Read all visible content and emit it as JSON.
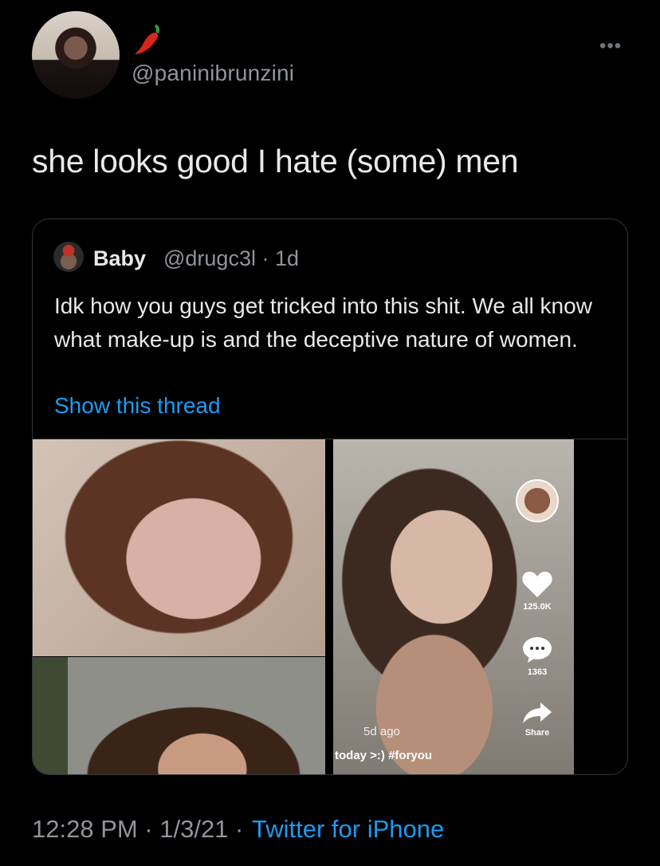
{
  "tweet": {
    "handle": "@paninibrunzini",
    "text": "she looks good I hate (some) men",
    "more_label": "•••",
    "timestamp": "12:28 PM · 1/3/21 ·",
    "source": "Twitter for iPhone"
  },
  "quote": {
    "name": "Baby",
    "meta": "@drugc3l · 1d",
    "text": "Idk how you guys get tricked into this shit. We all know what make-up is and the deceptive nature of women.",
    "show_thread": "Show this thread",
    "tiktok": {
      "likes": "125.0K",
      "comments": "1363",
      "share": "Share",
      "ago": "5d ago",
      "caption": "today >:) #foryou"
    }
  },
  "colors": {
    "background": "#000000",
    "link": "#1d9bf0",
    "muted": "#8e959c",
    "border": "#33373b"
  },
  "icons": [
    "hot-pepper-icon",
    "more-icon",
    "heart-icon",
    "comment-icon",
    "share-icon"
  ]
}
